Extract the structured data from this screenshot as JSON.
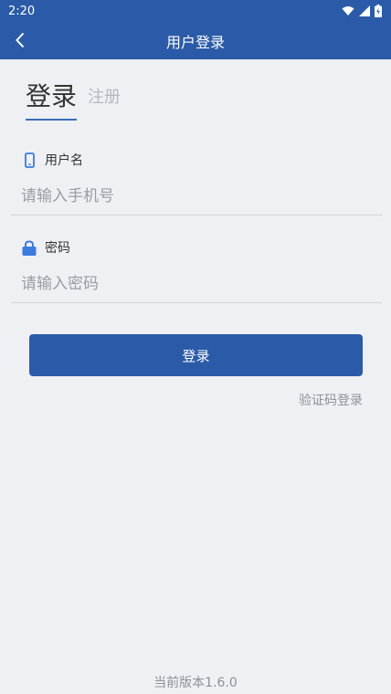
{
  "status_bar": {
    "time": "2:20",
    "icons": [
      "wifi-icon",
      "signal-icon",
      "battery-charging-icon"
    ]
  },
  "app_bar": {
    "title": "用户登录",
    "back_icon": "chevron-left-icon"
  },
  "tabs": {
    "active": "登录",
    "inactive": "注册"
  },
  "username": {
    "icon": "phone-icon",
    "label": "用户名",
    "placeholder": "请输入手机号"
  },
  "password": {
    "icon": "lock-icon",
    "label": "密码",
    "placeholder": "请输入密码"
  },
  "actions": {
    "login_label": "登录",
    "sms_login_label": "验证码登录"
  },
  "footer": {
    "version": "当前版本1.6.0"
  },
  "colors": {
    "primary": "#2b5ba8",
    "icon_accent": "#3b7be0",
    "background": "#eef0f4"
  }
}
